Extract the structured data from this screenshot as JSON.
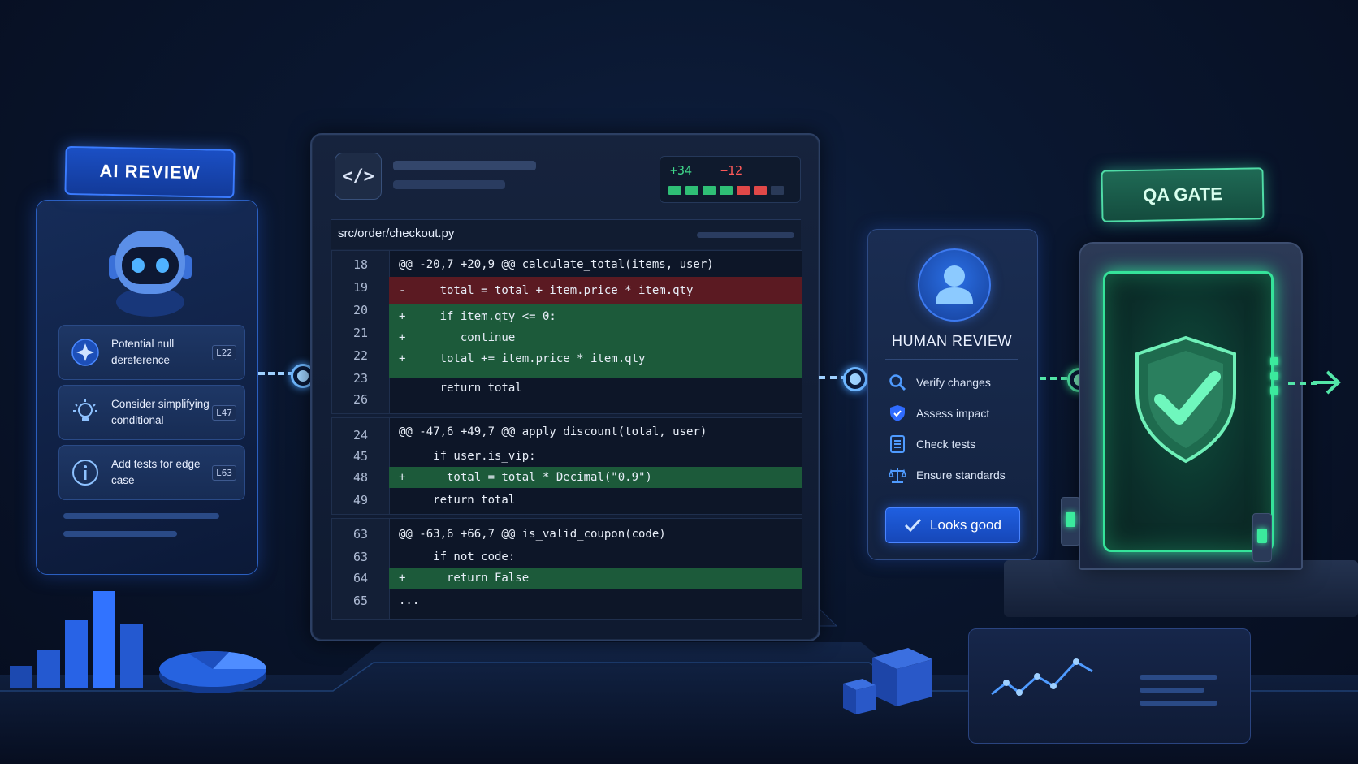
{
  "ai_review": {
    "tag": "AI REVIEW",
    "items": [
      {
        "icon": "sparkle-icon",
        "text": "Potential null dereference",
        "line": "L22"
      },
      {
        "icon": "lightbulb-icon",
        "text": "Consider simplifying conditional",
        "line": "L47"
      },
      {
        "icon": "info-icon",
        "text": "Add tests for edge case",
        "line": "L63"
      }
    ]
  },
  "code_review": {
    "icon": "</>",
    "additions": "+34",
    "deletions": "−12",
    "file": "src/order/checkout.py",
    "hunks": [
      {
        "header": "@@ -20,7 +20,9 @@ calculate_total(items, user)",
        "lines": [
          {
            "num": "18",
            "type": "header"
          },
          {
            "num": "19",
            "type": "del",
            "code": "-     total = total + item.price * item.qty"
          },
          {
            "num": "20",
            "type": "add",
            "code": "+     if item.qty <= 0:"
          },
          {
            "num": "21",
            "type": "add",
            "code": "+        continue"
          },
          {
            "num": "22",
            "type": "add",
            "code": "+     total += item.price * item.qty"
          },
          {
            "num": "23",
            "type": "ctx",
            "code": "      return total"
          },
          {
            "num": "26",
            "type": "ctx",
            "code": ""
          }
        ]
      },
      {
        "header": "@@ -47,6 +49,7 @@ apply_discount(total, user)",
        "lines": [
          {
            "num": "24",
            "type": "header"
          },
          {
            "num": "45",
            "type": "ctx",
            "code": "     if user.is_vip:"
          },
          {
            "num": "48",
            "type": "add",
            "code": "+      total = total * Decimal(\"0.9\")"
          },
          {
            "num": "49",
            "type": "ctx",
            "code": "     return total"
          }
        ]
      },
      {
        "header": "@@ -63,6 +66,7 @@ is_valid_coupon(code)",
        "lines": [
          {
            "num": "63",
            "type": "header"
          },
          {
            "num": "63",
            "type": "ctx",
            "code": "     if not code:"
          },
          {
            "num": "64",
            "type": "add",
            "code": "+      return False"
          },
          {
            "num": "65",
            "type": "ctx",
            "code": "..."
          }
        ]
      }
    ]
  },
  "human_review": {
    "title": "HUMAN REVIEW",
    "items": [
      {
        "icon": "search-icon",
        "text": "Verify changes"
      },
      {
        "icon": "shield-icon",
        "text": "Assess impact"
      },
      {
        "icon": "document-icon",
        "text": "Check tests"
      },
      {
        "icon": "scales-icon",
        "text": "Ensure standards"
      }
    ],
    "button": "Looks good"
  },
  "qa_gate": {
    "tag": "QA GATE"
  },
  "colors": {
    "accent_blue": "#2f6bff",
    "accent_green": "#35e39a",
    "add": "#3fd68a",
    "del": "#ff5a5a"
  }
}
